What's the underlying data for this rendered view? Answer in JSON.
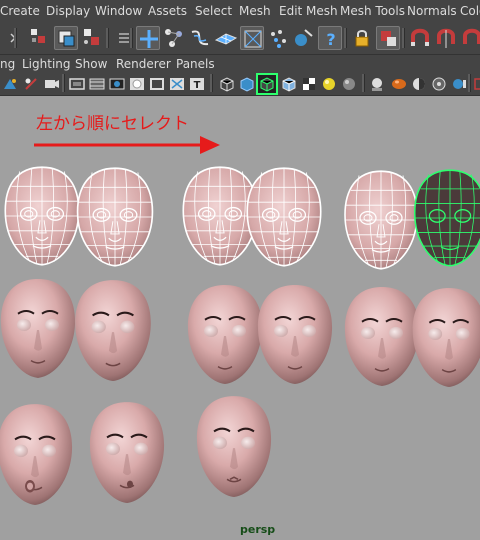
{
  "menubar": {
    "items": [
      "Create",
      "Display",
      "Window",
      "Assets",
      "Select",
      "Mesh",
      "Edit Mesh",
      "Mesh Tools",
      "Normals",
      "Colo"
    ]
  },
  "shelf": {
    "tools": [
      "shelf-handle-icon",
      "select-by-hierarchy-icon",
      "select-by-object-icon",
      "select-by-component-icon",
      "menu-collapse-icon",
      "move-tool-icon",
      "snap-to-points-icon",
      "snap-to-curves-icon",
      "snap-to-grid-icon",
      "snap-to-view-plane-icon",
      "snap-to-live-icon",
      "snap-to-magnet-icon",
      "help-icon",
      "lock-icon",
      "select-highlight-icon",
      "magnet-icon",
      "symmetry-magnet-icon",
      "soft-select-icon"
    ]
  },
  "panel_menu": {
    "items": [
      "ng",
      "Lighting",
      "Show",
      "Renderer",
      "Panels"
    ]
  },
  "panel_tools": {
    "icons": [
      "image-plane-icon",
      "film-gate-icon",
      "camera-icon",
      "resolution-gate-icon",
      "gate-mask-icon",
      "field-chart-icon",
      "grid-icon",
      "text-icon",
      "wireframe-icon",
      "smooth-shade-icon",
      "shaded-wireframe-icon",
      "textured-icon",
      "checker-icon",
      "lights-icon",
      "shadows-icon",
      "ambient-occlusion-icon",
      "motion-blur-icon",
      "isolate-icon",
      "xray-icon",
      "select-camera-icon"
    ]
  },
  "viewport": {
    "annotation": "左から順にセレクト",
    "camera_label": "persp",
    "selection_color": "#2eff6e",
    "arrow_color": "#e61b1b"
  }
}
